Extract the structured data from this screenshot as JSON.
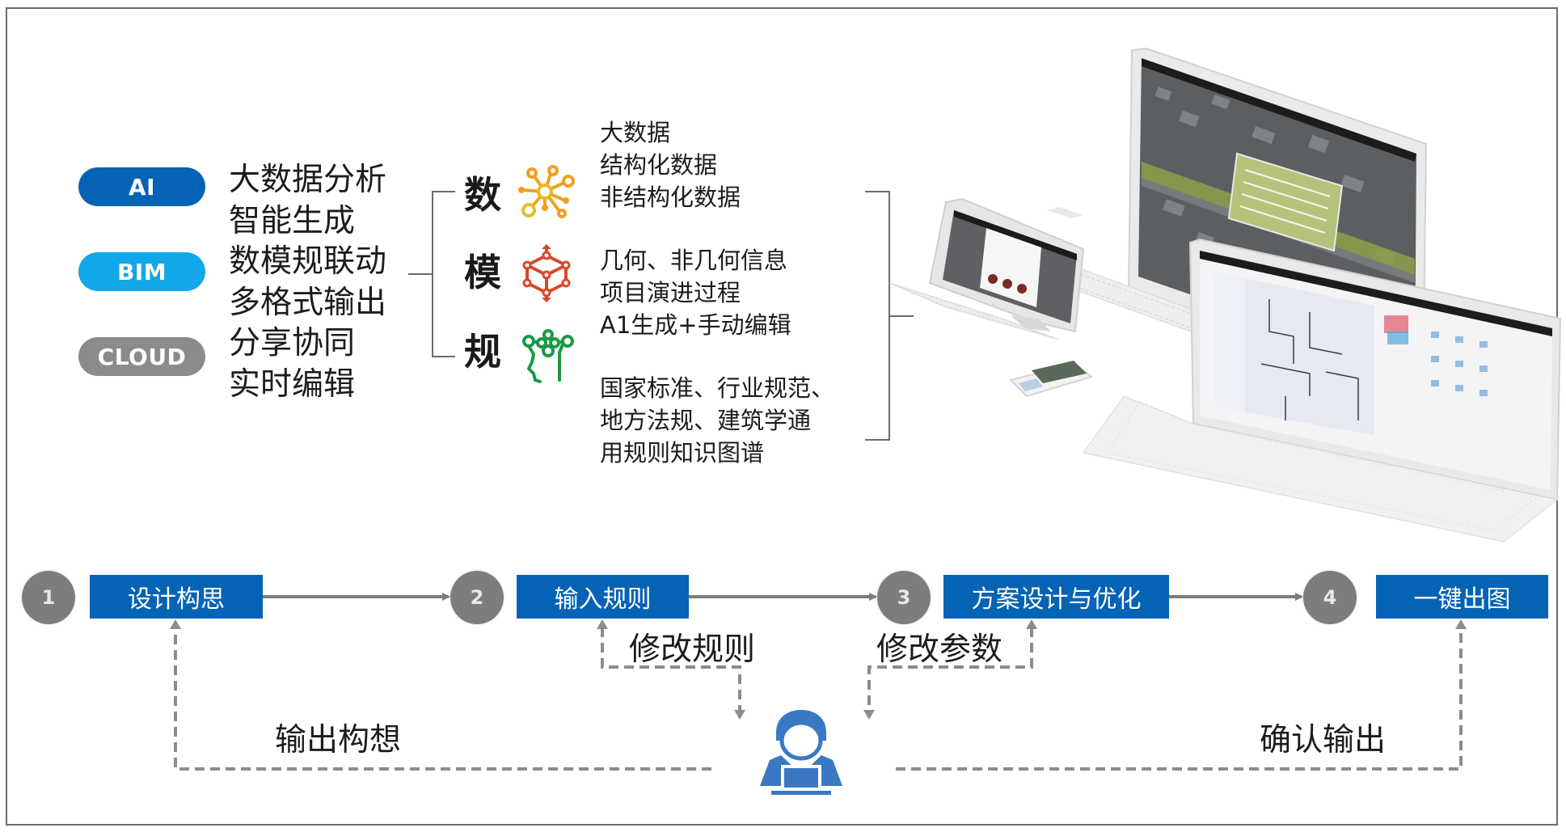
{
  "tech_pills": [
    {
      "label": "AI",
      "color": "#0563b5"
    },
    {
      "label": "BIM",
      "color": "#12a7e8"
    },
    {
      "label": "CLOUD",
      "color": "#8b8b8d"
    }
  ],
  "capabilities": [
    "大数据分析",
    "智能生成",
    "数模规联动",
    "多格式输出",
    "分享协同",
    "实时编辑"
  ],
  "pillars": [
    {
      "char": "数",
      "icon": "network-hub-icon",
      "icon_color": "#f0a020",
      "lines": [
        "大数据",
        "结构化数据",
        "非结构化数据"
      ]
    },
    {
      "char": "模",
      "icon": "cube-model-icon",
      "icon_color": "#d9472b",
      "lines": [
        "几何、非几何信息",
        "项目演进过程",
        "A1生成+手动编辑"
      ]
    },
    {
      "char": "规",
      "icon": "rule-graph-icon",
      "icon_color": "#1a9a45",
      "lines": [
        "国家标准、行业规范、",
        "地方法规、建筑学通",
        "用规则知识图谱"
      ]
    }
  ],
  "devices_illustration": {
    "label": "多终端设备展示：台式机、平板、手机、笔记本"
  },
  "workflow": {
    "steps": [
      {
        "number": "1",
        "label": "设计构思"
      },
      {
        "number": "2",
        "label": "输入规则"
      },
      {
        "number": "3",
        "label": "方案设计与优化"
      },
      {
        "number": "4",
        "label": "一键出图"
      }
    ],
    "feedback_labels": {
      "output_concept": "输出构想",
      "modify_rules": "修改规则",
      "modify_params": "修改参数",
      "confirm_output": "确认输出"
    },
    "step_box_color": "#0563b5",
    "step_circle_color": "#7d7d7f",
    "user_icon_color": "#3a78c3"
  }
}
